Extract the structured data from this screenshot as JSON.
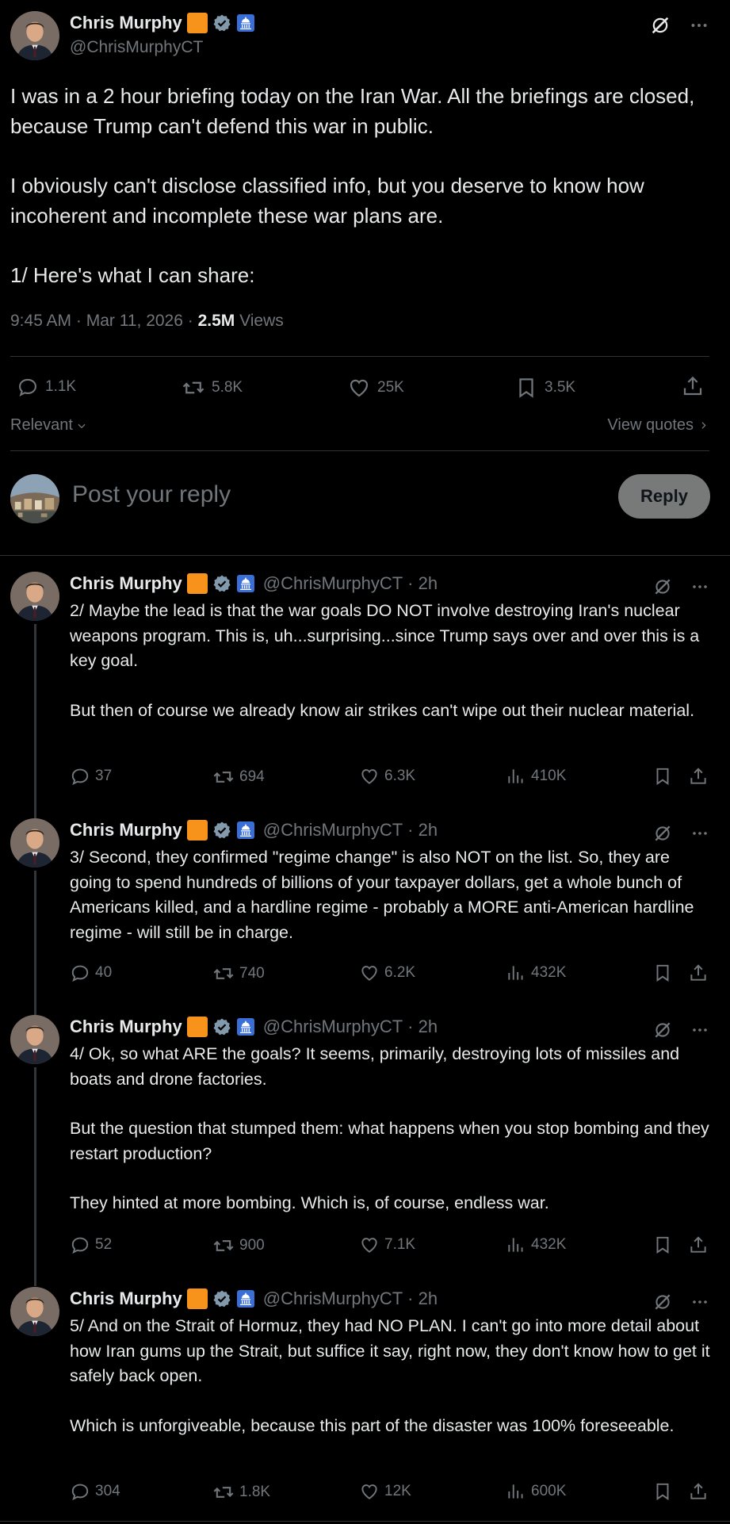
{
  "main_tweet": {
    "author_name": "Chris Murphy",
    "author_handle": "@ChrisMurphyCT",
    "paragraphs": [
      "I was in a 2 hour briefing today on the Iran War. All the briefings are closed, because Trump can't defend this war in public.",
      "I obviously can't disclose classified info, but you deserve to know how incoherent and incomplete these war plans are.",
      "1/ Here's what I can share:"
    ],
    "time": "9:45 AM",
    "date": "Mar 11, 2026",
    "views_count": "2.5M",
    "views_label": "Views",
    "replies": "1.1K",
    "reposts": "5.8K",
    "likes": "25K",
    "bookmarks": "3.5K"
  },
  "sort": {
    "label": "Relevant"
  },
  "view_quotes": "View quotes",
  "compose": {
    "placeholder": "Post your reply",
    "button": "Reply"
  },
  "replies": [
    {
      "name": "Chris Murphy",
      "handle": "@ChrisMurphyCT",
      "time": "· 2h",
      "paragraphs": [
        "2/ Maybe the lead is that the war goals DO NOT involve destroying Iran's nuclear weapons program. This is, uh...surprising...since Trump says over and over this is a key goal.",
        "But then of course we already know air strikes can't wipe out their nuclear material."
      ],
      "replies": "37",
      "reposts": "694",
      "likes": "6.3K",
      "views": "410K"
    },
    {
      "name": "Chris Murphy",
      "handle": "@ChrisMurphyCT",
      "time": "· 2h",
      "paragraphs": [
        "3/ Second, they confirmed \"regime change\" is also NOT on the list. So, they are going to spend hundreds of billions of your taxpayer dollars, get a whole bunch of Americans killed, and a hardline regime - probably a MORE anti-American hardline regime - will still be in charge."
      ],
      "replies": "40",
      "reposts": "740",
      "likes": "6.2K",
      "views": "432K"
    },
    {
      "name": "Chris Murphy",
      "handle": "@ChrisMurphyCT",
      "time": "· 2h",
      "paragraphs": [
        "4/ Ok, so what ARE the goals? It seems, primarily, destroying lots of missiles and boats and drone factories.",
        "But the question that stumped them: what happens when you stop bombing and they restart production?",
        "They hinted at more bombing. Which is, of course, endless war."
      ],
      "replies": "52",
      "reposts": "900",
      "likes": "7.1K",
      "views": "432K"
    },
    {
      "name": "Chris Murphy",
      "handle": "@ChrisMurphyCT",
      "time": "· 2h",
      "paragraphs": [
        "5/ And on the Strait of Hormuz, they had NO PLAN. I can't go into more detail about how Iran gums up the Strait, but suffice it say, right now, they don't know how to get it safely back open.",
        "Which is unforgiveable, because this part of the disaster was 100% foreseeable."
      ],
      "replies": "304",
      "reposts": "1.8K",
      "likes": "12K",
      "views": "600K"
    }
  ],
  "colors": {
    "background": "#000000",
    "text": "#e7e9ea",
    "muted": "#71767b",
    "divider": "#2f3336",
    "verified": "#829aab",
    "badge_orange": "#f7931a",
    "badge_blue": "#1d9bf0"
  },
  "icons": [
    "grok-icon",
    "more-icon",
    "verified-icon",
    "capitol-icon",
    "reply-icon",
    "repost-icon",
    "like-icon",
    "bookmark-icon",
    "share-icon",
    "views-icon",
    "chevron-down-icon",
    "chevron-right-icon"
  ]
}
